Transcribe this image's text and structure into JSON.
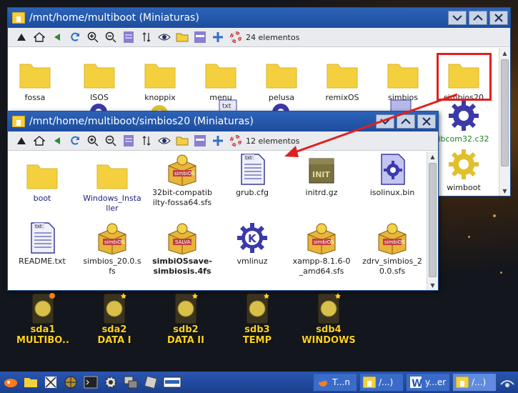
{
  "desktop": {
    "drives": [
      {
        "name": "sda1",
        "label": "MULTIBO..",
        "badge": "orange"
      },
      {
        "name": "sda2",
        "label": "DATA I",
        "badge": "yellow"
      },
      {
        "name": "sdb2",
        "label": "DATA II",
        "badge": "yellow"
      },
      {
        "name": "sdb3",
        "label": "TEMP",
        "badge": "yellow"
      },
      {
        "name": "sdb4",
        "label": "WINDOWS",
        "badge": "yellow"
      }
    ]
  },
  "back_window": {
    "title": "/mnt/home/multiboot (Miniaturas)",
    "item_count": "24 elementos",
    "items": [
      {
        "label": "fossa",
        "icon": "folder-icon"
      },
      {
        "label": "ISOS",
        "icon": "folder-icon"
      },
      {
        "label": "knoppix",
        "icon": "folder-icon"
      },
      {
        "label": "menu",
        "icon": "folder-icon"
      },
      {
        "label": "pelusa",
        "icon": "folder-icon"
      },
      {
        "label": "remixOS",
        "icon": "folder-icon"
      },
      {
        "label": "simbios",
        "icon": "folder-icon"
      },
      {
        "label": "simbios20",
        "icon": "folder-icon"
      },
      {
        "label": "ibcom32.c32",
        "icon": "gear-icon"
      },
      {
        "label": "wimboot",
        "icon": "gear-icon"
      }
    ]
  },
  "front_window": {
    "title": "/mnt/home/multiboot/simbios20 (Miniaturas)",
    "item_count": "12 elementos",
    "items": [
      {
        "label": "boot",
        "icon": "folder-icon"
      },
      {
        "label": "Windows_Installer",
        "icon": "folder-icon"
      },
      {
        "label": "32bit-compatibilty-fossa64.sfs",
        "icon": "simbios-box-icon"
      },
      {
        "label": "grub.cfg",
        "icon": "txt-file-icon"
      },
      {
        "label": "initrd.gz",
        "icon": "init-archive-icon"
      },
      {
        "label": "isolinux.bin",
        "icon": "binary-file-icon"
      },
      {
        "label": "README.txt",
        "icon": "txt-file-icon"
      },
      {
        "label": "simbios_20.0.sfs",
        "icon": "simbios-box-icon"
      },
      {
        "label": "simbiOSsave-simbiosis.4fs",
        "icon": "simbios-save-icon"
      },
      {
        "label": "vmlinuz",
        "icon": "kernel-gear-icon"
      },
      {
        "label": "xampp-8.1.6-0_amd64.sfs",
        "icon": "simbios-box-icon"
      },
      {
        "label": "zdrv_simbios_20.0.sfs",
        "icon": "simbios-box-icon"
      }
    ]
  },
  "taskbar": {
    "tasks": [
      {
        "label": "T...n",
        "icon": "firefox-icon"
      },
      {
        "label": "/...)",
        "icon": "folder-icon"
      },
      {
        "label": "y...er",
        "icon": "word-icon"
      },
      {
        "label": "/...)",
        "icon": "folder-icon"
      }
    ]
  },
  "colors": {
    "title_bar": "#2c63b8",
    "folder": "#f4d03f",
    "drive_label": "#ffd21f",
    "highlight": "#e02020"
  }
}
